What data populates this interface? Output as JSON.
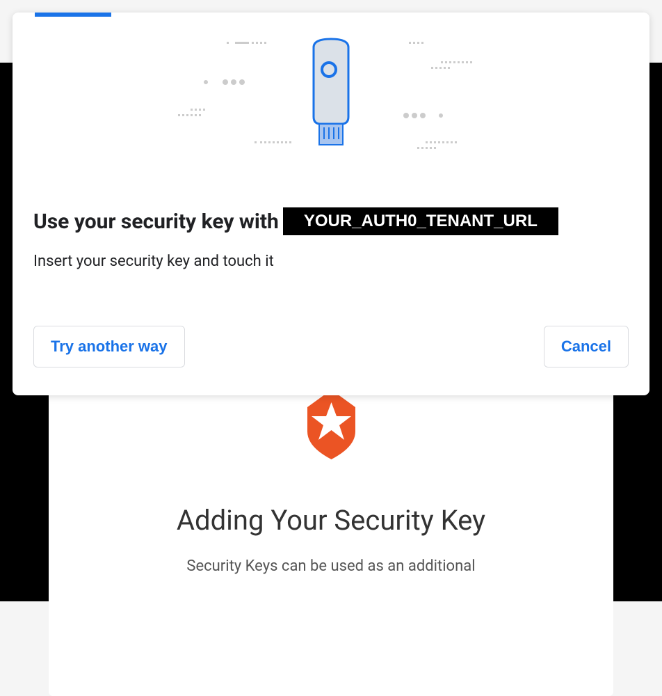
{
  "dialog": {
    "title_prefix": "Use your security key with",
    "tenant_url": "YOUR_AUTH0_TENANT_URL",
    "subtitle": "Insert your security key and touch it",
    "try_another_label": "Try another way",
    "cancel_label": "Cancel"
  },
  "underlying": {
    "title": "Adding Your Security Key",
    "subtitle": "Security Keys can be used as an additional"
  },
  "colors": {
    "primary": "#1a73e8",
    "auth0_orange": "#eb5424"
  }
}
